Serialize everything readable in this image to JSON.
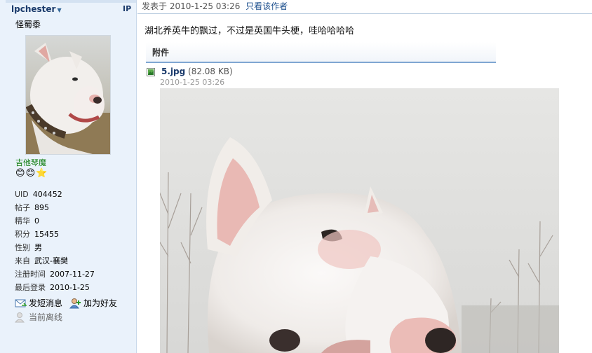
{
  "user": {
    "username": "lpchester",
    "ip_label": "IP",
    "nickname": "怪蜀黍",
    "rank": "吉他琴魔",
    "stars": [
      "😊",
      "😊",
      "⭐"
    ],
    "stats": [
      {
        "key": "UID",
        "value": "404452"
      },
      {
        "key": "帖子",
        "value": "895"
      },
      {
        "key": "精华",
        "value": "0"
      },
      {
        "key": "积分",
        "value": "15455"
      },
      {
        "key": "性别",
        "value": "男"
      },
      {
        "key": "来自",
        "value": "武汉-襄樊"
      },
      {
        "key": "注册时间",
        "value": "2007-11-27"
      },
      {
        "key": "最后登录",
        "value": "2010-1-25"
      }
    ],
    "actions": {
      "send_message": "发短消息",
      "add_friend": "加为好友",
      "offline": "当前离线"
    }
  },
  "post": {
    "posted_label": "发表于",
    "posted_time": "2010-1-25 03:26",
    "author_only": "只看该作者",
    "text": "湖北养英牛的飘过，不过是英国牛头梗，哇哈哈哈哈",
    "attachment_label": "附件",
    "file": {
      "name": "5.jpg",
      "size": "(82.08 KB)",
      "date": "2010-1-25 03:26"
    }
  },
  "colors": {
    "sidebar_bg": "#eaf2fb",
    "link": "#1a4d8c",
    "rank_green": "#0a7a0a"
  }
}
